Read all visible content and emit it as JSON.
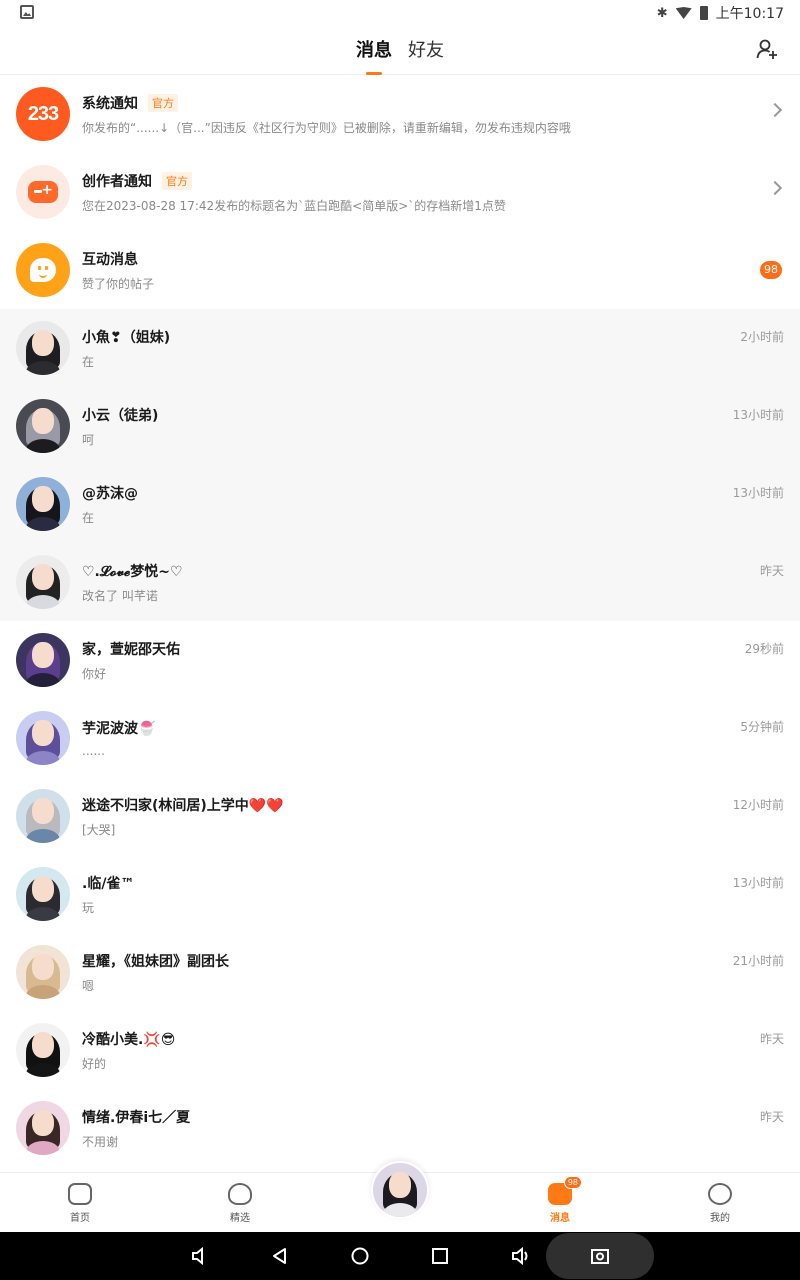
{
  "status_bar": {
    "time": "上午10:17",
    "icons": [
      "bluetooth-icon",
      "wifi-icon",
      "battery-icon"
    ]
  },
  "header": {
    "tabs": [
      {
        "label": "消息",
        "active": true
      },
      {
        "label": "好友",
        "active": false
      }
    ],
    "add_friend_icon": "add-friend-icon"
  },
  "system_items": [
    {
      "name": "系统通知",
      "tag": "官方",
      "preview": "你发布的“......↓（官...”因违反《社区行为守则》已被删除，请重新编辑，勿发布违规内容哦",
      "avatar_text": "233"
    },
    {
      "name": "创作者通知",
      "tag": "官方",
      "preview": "您在2023-08-28 17:42发布的标题名为`蓝白跑酷<简单版>`的存档新增1点赞"
    },
    {
      "name": "互动消息",
      "preview": "赞了你的帖子",
      "badge": "98"
    }
  ],
  "chats": [
    {
      "name": "小魚❣（姐妹)",
      "preview": "在",
      "time": "2小时前"
    },
    {
      "name": "小云（徒弟)",
      "preview": "呵",
      "time": "13小时前"
    },
    {
      "name": "@苏沫@",
      "preview": "在",
      "time": "13小时前"
    },
    {
      "name": "♡.𝓛𝓸𝓿𝓮梦悦~♡",
      "preview": "改名了   叫芊诺",
      "time": "昨天"
    },
    {
      "name": "家，萱妮邵天佑",
      "preview": "你好",
      "time": "29秒前"
    },
    {
      "name": "芋泥波波🍧",
      "preview": "......",
      "time": "5分钟前"
    },
    {
      "name": "迷途不归家(林间居)上学中❤️❤️",
      "preview": "[大哭]",
      "time": "12小时前"
    },
    {
      "name": ".临/雀™",
      "preview": "玩",
      "time": "13小时前"
    },
    {
      "name": "星耀，《姐妹团》副团长",
      "preview": "嗯",
      "time": "21小时前"
    },
    {
      "name": "冷酷小美.💢😎",
      "preview": "好的",
      "time": "昨天"
    },
    {
      "name": "情绪.伊春i七／夏",
      "preview": "不用谢",
      "time": "昨天"
    }
  ],
  "bottom_nav": [
    {
      "label": "首页",
      "icon": "gamepad-icon"
    },
    {
      "label": "精选",
      "icon": "heart-icon"
    },
    {
      "label": "消息",
      "icon": "message-icon",
      "badge": "98",
      "active": true
    },
    {
      "label": "我的",
      "icon": "face-icon"
    }
  ],
  "colors": {
    "accent": "#ff7a14",
    "badge": "#ff6d1a",
    "pinned_bg": "#f7f7f7"
  }
}
